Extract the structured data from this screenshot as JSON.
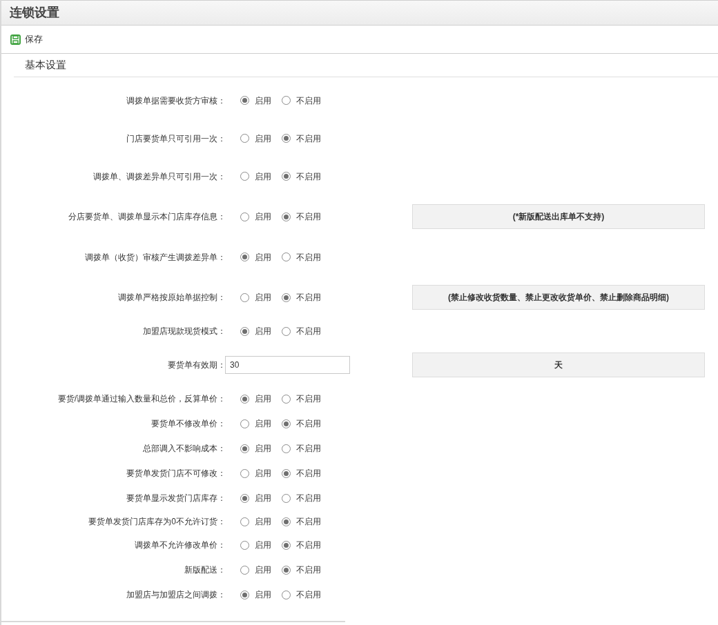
{
  "window": {
    "title": "连锁设置"
  },
  "toolbar": {
    "save_label": "保存"
  },
  "section": {
    "title": "基本设置"
  },
  "settings": [
    {
      "kind": "radio",
      "label": "调拨单据需要收货方审核：",
      "options": [
        {
          "label": "启用",
          "selected": true
        },
        {
          "label": "不启用",
          "selected": false
        }
      ]
    },
    {
      "kind": "radio",
      "label": "门店要货单只可引用一次：",
      "options": [
        {
          "label": "启用",
          "selected": false
        },
        {
          "label": "不启用",
          "selected": true
        }
      ]
    },
    {
      "kind": "radio",
      "label": "调拨单、调拨差异单只可引用一次：",
      "options": [
        {
          "label": "启用",
          "selected": false
        },
        {
          "label": "不启用",
          "selected": true
        }
      ]
    },
    {
      "kind": "radio",
      "label": "分店要货单、调拨单显示本门店库存信息：",
      "options": [
        {
          "label": "启用",
          "selected": false
        },
        {
          "label": "不启用",
          "selected": true
        }
      ],
      "note": "(*新版配送出库单不支持)"
    },
    {
      "kind": "radio",
      "label": "调拨单（收货）审核产生调拨差异单：",
      "options": [
        {
          "label": "启用",
          "selected": true
        },
        {
          "label": "不启用",
          "selected": false
        }
      ]
    },
    {
      "kind": "radio",
      "label": "调拨单严格按原始单据控制：",
      "options": [
        {
          "label": "启用",
          "selected": false
        },
        {
          "label": "不启用",
          "selected": true
        }
      ],
      "note": "(禁止修改收货数量、禁止更改收货单价、禁止删除商品明细)"
    },
    {
      "kind": "radio",
      "label": "加盟店现款现货模式：",
      "options": [
        {
          "label": "启用",
          "selected": true
        },
        {
          "label": "不启用",
          "selected": false
        }
      ]
    },
    {
      "kind": "input",
      "label": "要货单有效期：",
      "value": "30",
      "note": "天"
    },
    {
      "kind": "radio",
      "label": "要货/调拨单通过输入数量和总价，反算单价：",
      "options": [
        {
          "label": "启用",
          "selected": true
        },
        {
          "label": "不启用",
          "selected": false
        }
      ]
    },
    {
      "kind": "radio",
      "label": "要货单不修改单价：",
      "options": [
        {
          "label": "启用",
          "selected": false
        },
        {
          "label": "不启用",
          "selected": true
        }
      ]
    },
    {
      "kind": "radio",
      "label": "总部调入不影响成本：",
      "options": [
        {
          "label": "启用",
          "selected": true
        },
        {
          "label": "不启用",
          "selected": false
        }
      ]
    },
    {
      "kind": "radio",
      "label": "要货单发货门店不可修改：",
      "options": [
        {
          "label": "启用",
          "selected": false
        },
        {
          "label": "不启用",
          "selected": true
        }
      ]
    },
    {
      "kind": "radio",
      "label": "要货单显示发货门店库存：",
      "options": [
        {
          "label": "启用",
          "selected": true
        },
        {
          "label": "不启用",
          "selected": false
        }
      ]
    },
    {
      "kind": "radio",
      "label": "要货单发货门店库存为0不允许订货：",
      "options": [
        {
          "label": "启用",
          "selected": false
        },
        {
          "label": "不启用",
          "selected": true
        }
      ]
    },
    {
      "kind": "radio",
      "label": "调拨单不允许修改单价：",
      "options": [
        {
          "label": "启用",
          "selected": false
        },
        {
          "label": "不启用",
          "selected": true
        }
      ]
    },
    {
      "kind": "radio",
      "label": "新版配送：",
      "options": [
        {
          "label": "启用",
          "selected": false
        },
        {
          "label": "不启用",
          "selected": true
        }
      ]
    },
    {
      "kind": "radio",
      "label": "加盟店与加盟店之间调拨：",
      "options": [
        {
          "label": "启用",
          "selected": true
        },
        {
          "label": "不启用",
          "selected": false
        }
      ]
    }
  ]
}
